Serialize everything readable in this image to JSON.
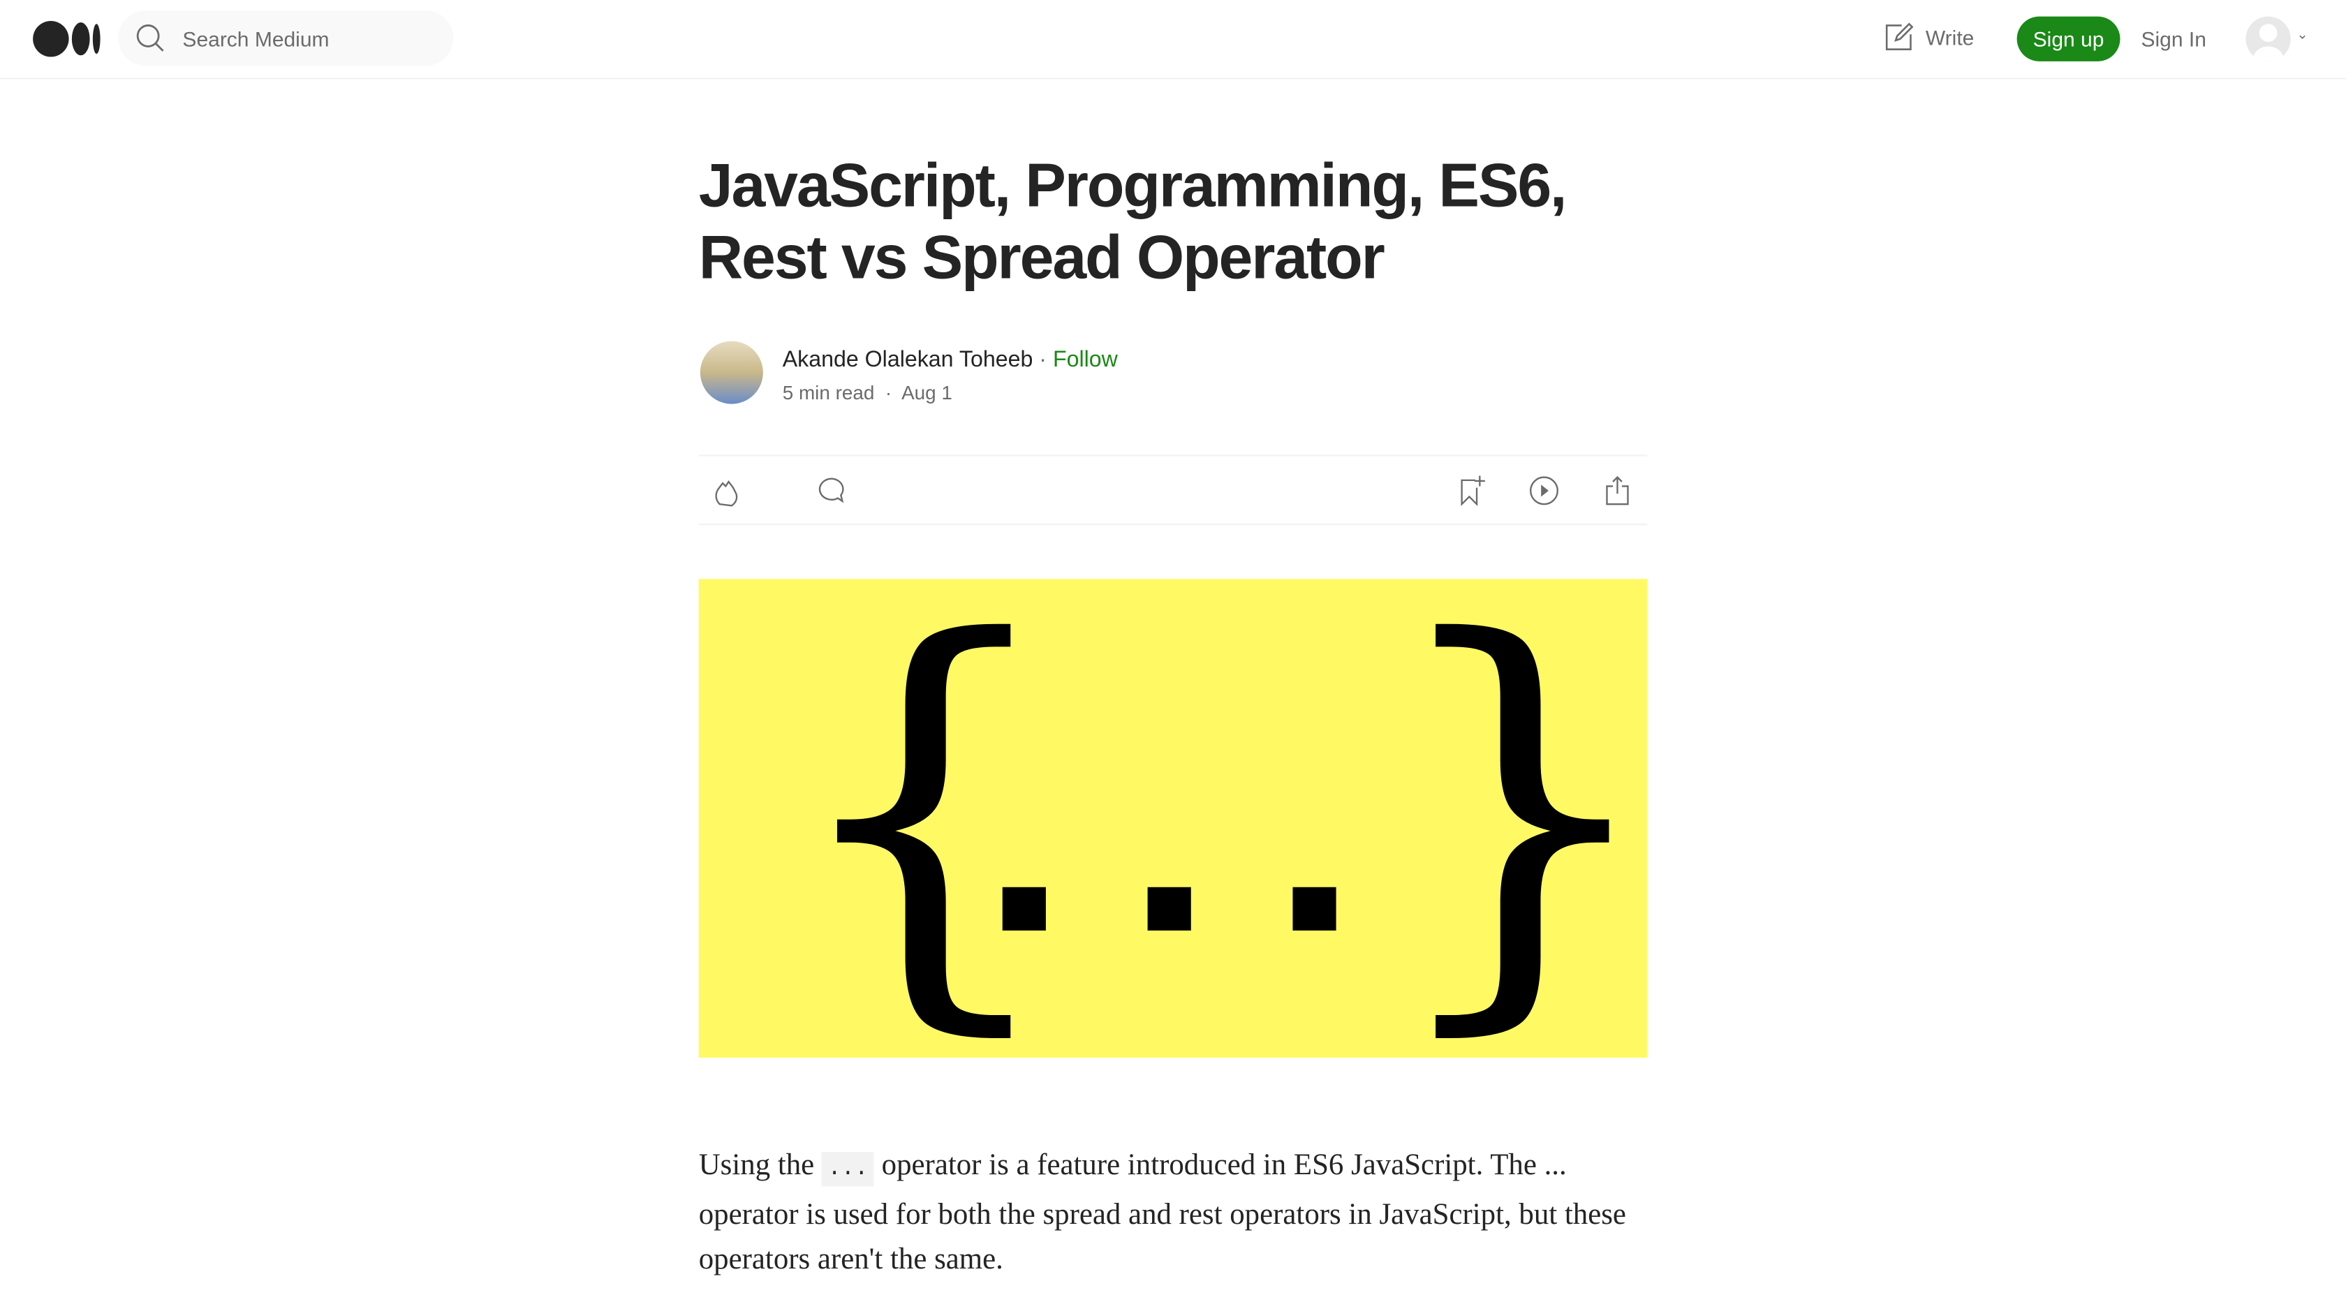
{
  "header": {
    "search_placeholder": "Search Medium",
    "write": "Write",
    "sign_up": "Sign up",
    "sign_in": "Sign In"
  },
  "article": {
    "title": "JavaScript, Programming, ES6, Rest vs Spread Operator",
    "author": "Akande Olalekan Toheeb",
    "follow": "Follow",
    "read_time": "5 min read",
    "date": "Aug 1",
    "hero_text": "{...}",
    "para_before": "Using the ",
    "para_code": "...",
    "para_after": " operator is a feature introduced in ES6 JavaScript. The ... operator is used for both the spread and rest operators in JavaScript, but these operators aren't the same."
  },
  "colors": {
    "accent": "#1a8917",
    "hero_bg": "#fff964"
  }
}
